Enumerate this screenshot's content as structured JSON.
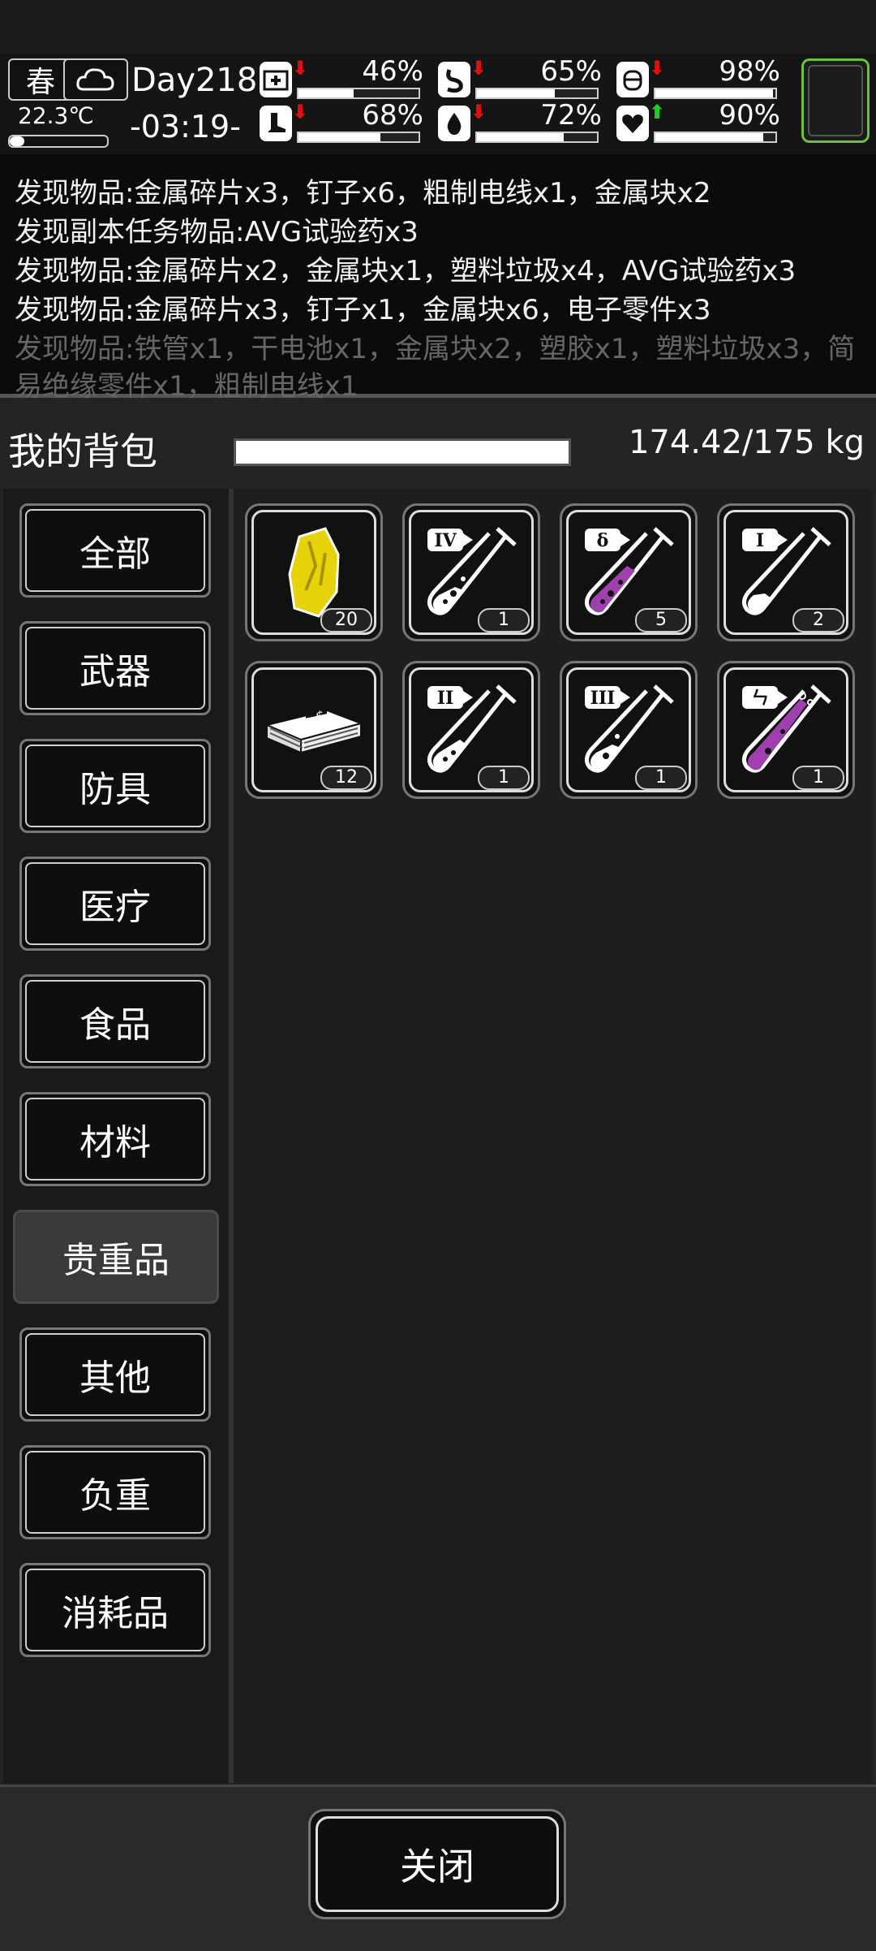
{
  "status": {
    "season": "春",
    "temperature": "22.3℃",
    "day": "Day218",
    "time": "-03:19-",
    "stats": [
      {
        "name": "health",
        "value": "46%",
        "fill": 0.46,
        "trend": "down",
        "trend_color": "#e01010"
      },
      {
        "name": "hunger",
        "value": "65%",
        "fill": 0.65,
        "trend": "down",
        "trend_color": "#e01010"
      },
      {
        "name": "stamina",
        "value": "98%",
        "fill": 0.98,
        "trend": "down",
        "trend_color": "#e01010"
      },
      {
        "name": "walk",
        "value": "68%",
        "fill": 0.68,
        "trend": "down",
        "trend_color": "#e01010"
      },
      {
        "name": "water",
        "value": "72%",
        "fill": 0.72,
        "trend": "down",
        "trend_color": "#e01010"
      },
      {
        "name": "mood",
        "value": "90%",
        "fill": 0.9,
        "trend": "up",
        "trend_color": "#20d020"
      }
    ]
  },
  "log": [
    "发现物品:金属碎片x3，钉子x6，粗制电线x1，金属块x2",
    "发现副本任务物品:AVG试验药x3",
    "发现物品:金属碎片x2，金属块x1，塑料垃圾x4，AVG试验药x3",
    "发现物品:金属碎片x3，钉子x1，金属块x6，电子零件x3",
    "发现物品:铁管x1，干电池x1，金属块x2，塑胶x1，塑料垃圾x3，简",
    "易绝缘零件x1，粗制电线x1"
  ],
  "bag": {
    "title": "我的背包",
    "weight": "174.42/175 kg",
    "weight_fill": 0.997
  },
  "categories": [
    "全部",
    "武器",
    "防具",
    "医疗",
    "食品",
    "材料",
    "贵重品",
    "其他",
    "负重",
    "消耗品"
  ],
  "active_category": "贵重品",
  "items": [
    {
      "icon": "yellow-crystal-icon",
      "count": "20"
    },
    {
      "icon": "test-tube-iv-icon",
      "label": "IV",
      "count": "1",
      "liquid": "#ffffff"
    },
    {
      "icon": "test-tube-delta-icon",
      "label": "δ",
      "count": "5",
      "liquid": "#a040b0"
    },
    {
      "icon": "test-tube-i-icon",
      "label": "I",
      "count": "2",
      "liquid": "#ffffff"
    },
    {
      "icon": "cash-stack-icon",
      "count": "12"
    },
    {
      "icon": "test-tube-ii-icon",
      "label": "II",
      "count": "1",
      "liquid": "#ffffff"
    },
    {
      "icon": "test-tube-iii-icon",
      "label": "III",
      "count": "1",
      "liquid": "#ffffff"
    },
    {
      "icon": "test-tube-purple-icon",
      "label": "ㄣ",
      "count": "1",
      "liquid": "#a040b0"
    }
  ],
  "close_label": "关闭"
}
